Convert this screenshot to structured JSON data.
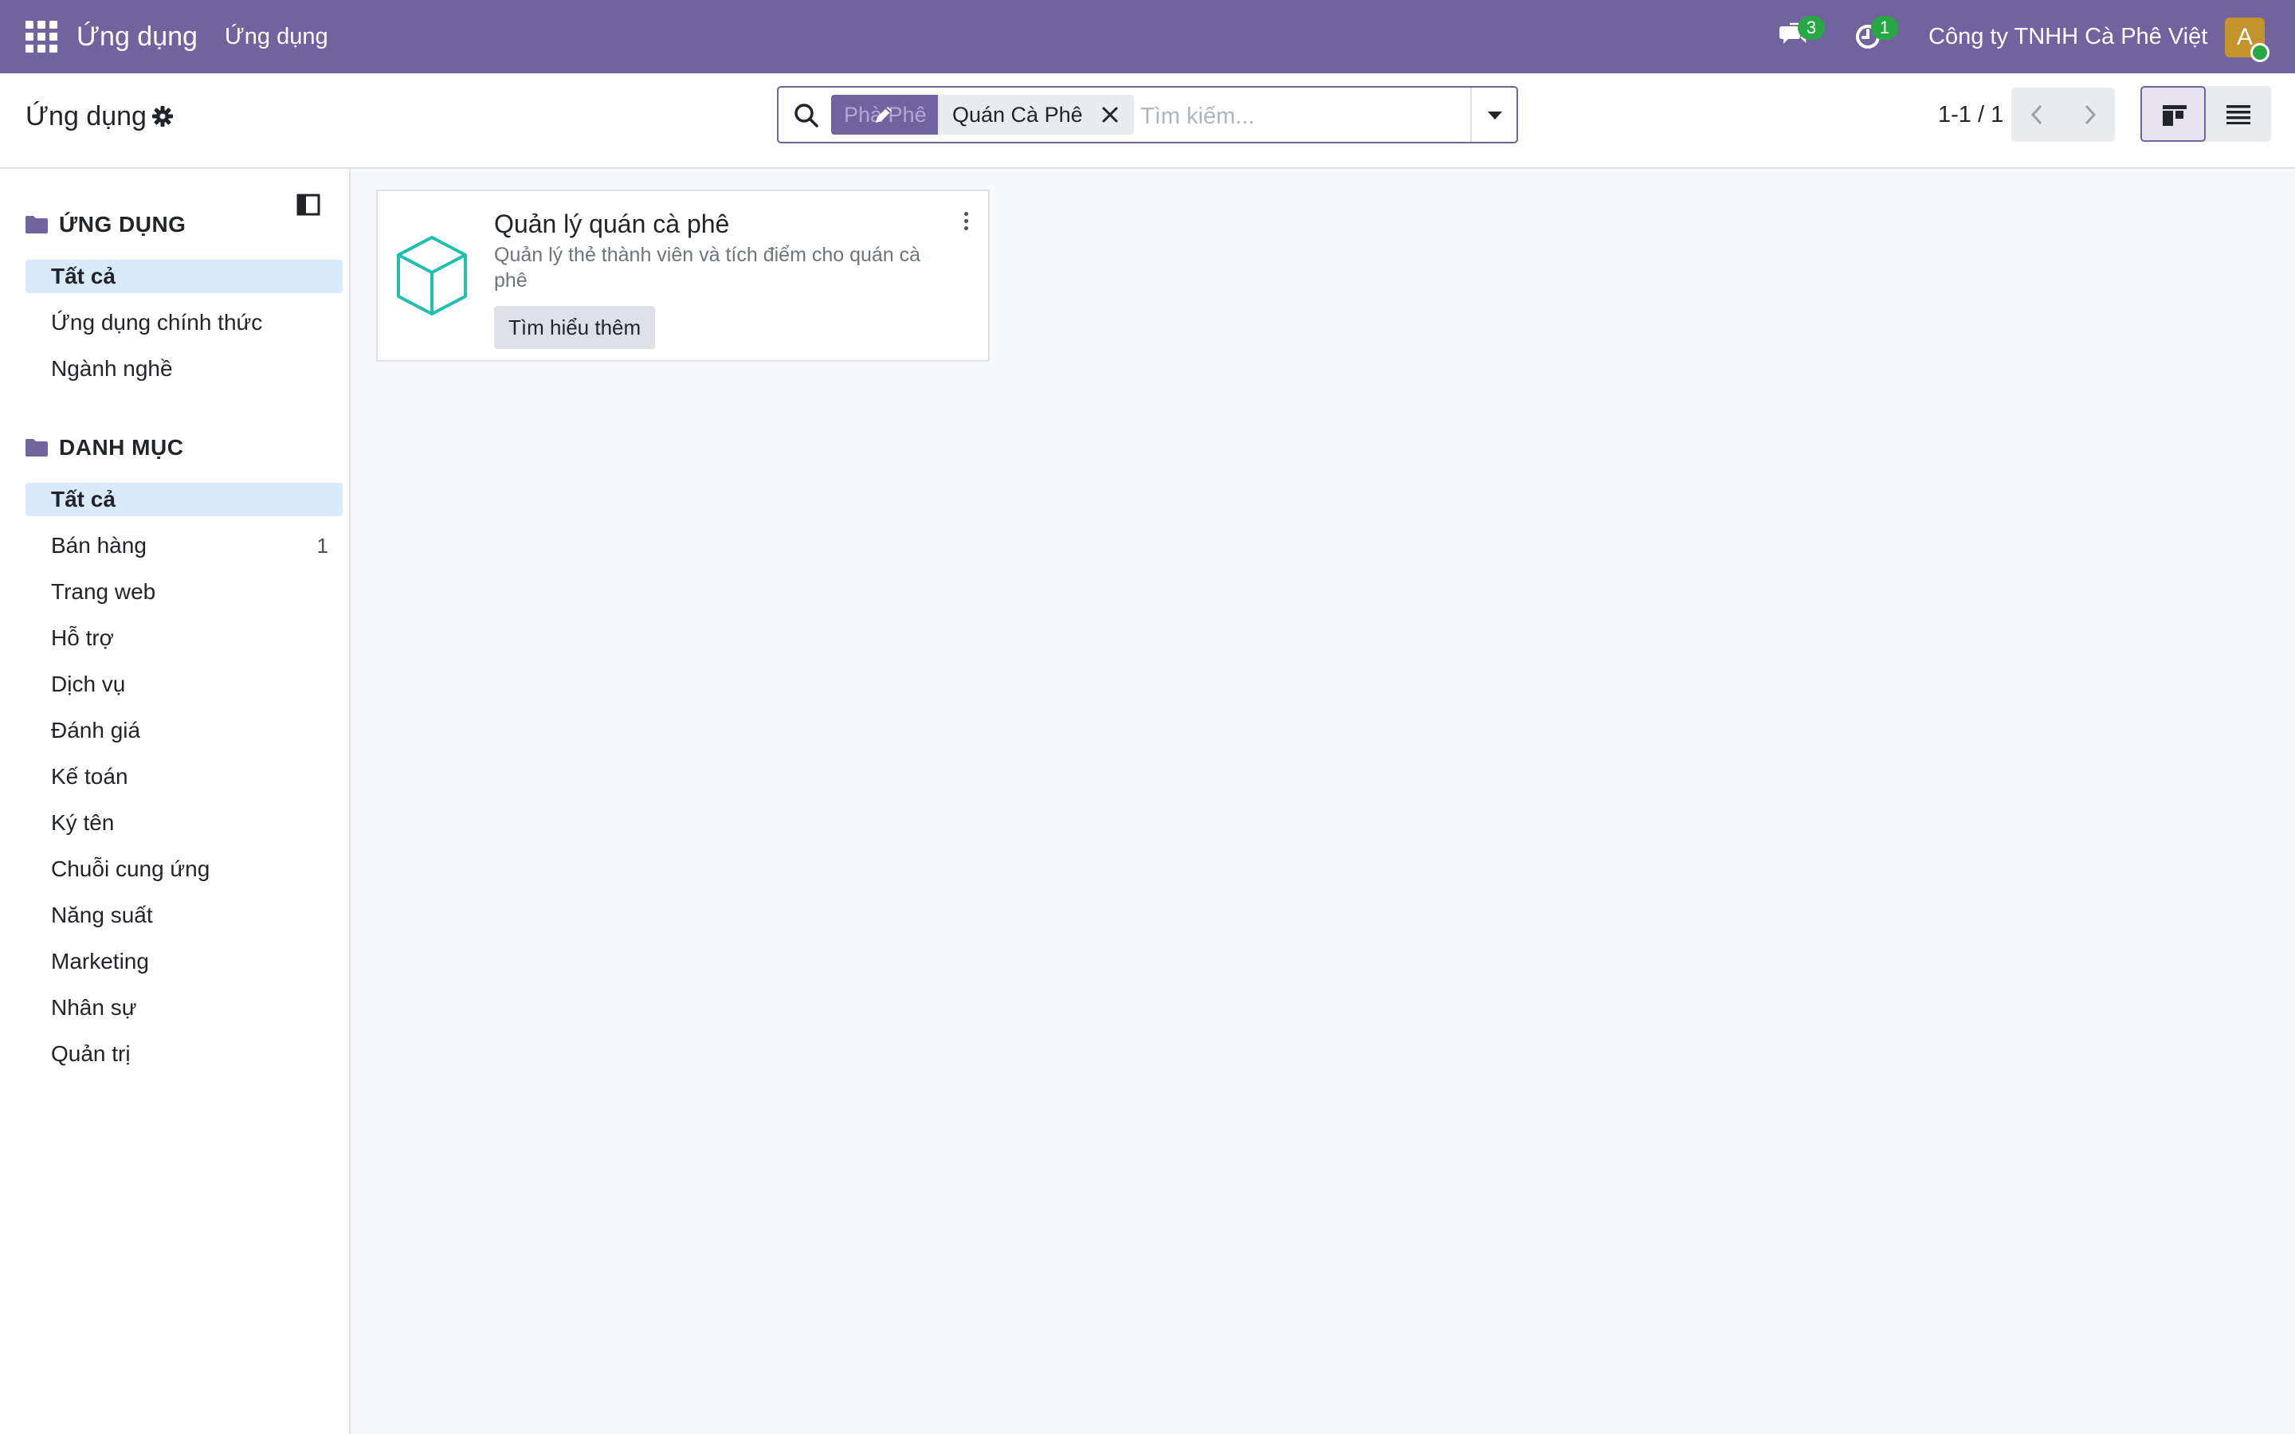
{
  "navbar": {
    "brand": "Ứng dụng",
    "menu_item": "Ứng dụng",
    "messages_count": "3",
    "activities_count": "1",
    "company": "Công ty TNHH Cà Phê Việt",
    "avatar_initial": "A"
  },
  "control_panel": {
    "title": "Ứng dụng",
    "search": {
      "facet_label": "Phà Phê",
      "facet_value": "Quán Cà Phê",
      "placeholder": "Tìm kiếm..."
    },
    "pager": "1-1 / 1"
  },
  "sidebar": {
    "apps_section": {
      "header": "ỨNG DỤNG",
      "items": [
        {
          "label": "Tất cả",
          "active": true
        },
        {
          "label": "Ứng dụng chính thức"
        },
        {
          "label": "Ngành nghề"
        }
      ]
    },
    "categories_section": {
      "header": "DANH MỤC",
      "items": [
        {
          "label": "Tất cả",
          "active": true
        },
        {
          "label": "Bán hàng",
          "count": "1"
        },
        {
          "label": "Trang web"
        },
        {
          "label": "Hỗ trợ"
        },
        {
          "label": "Dịch vụ"
        },
        {
          "label": "Đánh giá"
        },
        {
          "label": "Kế toán"
        },
        {
          "label": "Ký tên"
        },
        {
          "label": "Chuỗi cung ứng"
        },
        {
          "label": "Năng suất"
        },
        {
          "label": "Marketing"
        },
        {
          "label": "Nhân sự"
        },
        {
          "label": "Quản trị"
        }
      ]
    }
  },
  "cards": [
    {
      "title": "Quản lý quán cà phê",
      "description": "Quản lý thẻ thành viên và tích điểm cho quán cà phê",
      "button": "Tìm hiểu thêm"
    }
  ],
  "colors": {
    "brand": "#71639e",
    "active_filter": "#d9ebf9",
    "module_icon": "#1fc0b0"
  }
}
